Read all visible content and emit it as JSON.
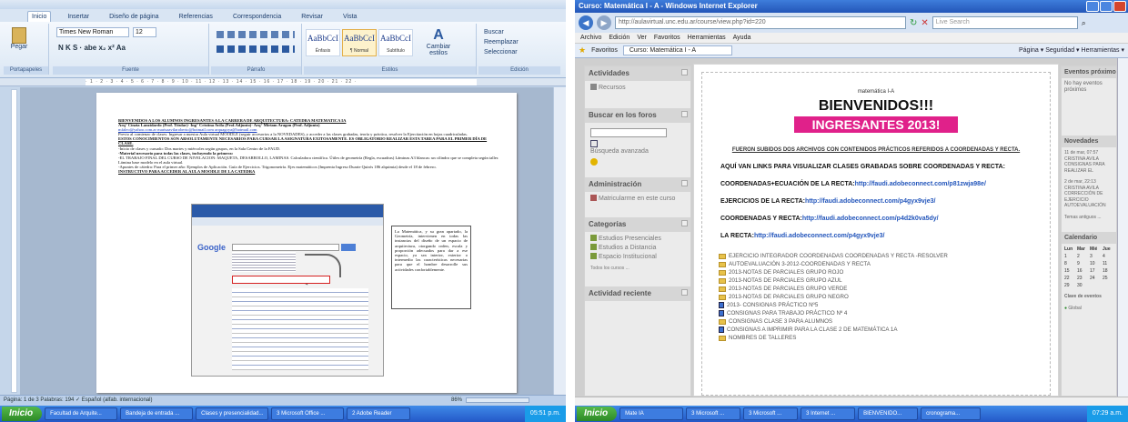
{
  "word": {
    "tabs": [
      "Inicio",
      "Insertar",
      "Diseño de página",
      "Referencias",
      "Correspondencia",
      "Revisar",
      "Vista"
    ],
    "paste_label": "Pegar",
    "font_name": "Times New Roman",
    "font_size": "12",
    "format_row": "N K S · abe x₂ x² Aa",
    "group_labels": [
      "Portapapeles",
      "Fuente",
      "Párrafo",
      "Estilos",
      "Edición"
    ],
    "styles": [
      {
        "sample": "AaBbCcI",
        "name": "Énfasis"
      },
      {
        "sample": "AaBbCcI",
        "name": "¶ Normal"
      },
      {
        "sample": "AaBbCcI",
        "name": "Subtítulo"
      }
    ],
    "change_styles": "Cambiar estilos",
    "edit_items": [
      "Buscar",
      "Reemplazar",
      "Seleccionar"
    ],
    "doc": {
      "heading": "BIENVENIDOS A LOS ALUMNOS INGRESANTES A LA CARRERA DE ARQUITECTURA: CATEDRA MATEMATICA IA",
      "staff": "Arq° Cinzia Lanzidardo (Prof. Titular)- Ing° Cristina Avila (Prof.Adjunto)- Arq° Miriam Aragon (Prof. Adjunto)",
      "emails": "mfaleo@yahoo.com.ar  marisaavilaroberto@hotmail.com  arquagoya@hotmail.com",
      "p1": "Previo al comienzo de clases: Ingresar a nuestra Aula virtual MOODLE (seguir accesorios a la NOVEDADES), y acceder a las clases grabadas, teoría y práctica, resolver la Ejercitación en hojas cuadriculadas.",
      "p2": "ESTOS CONOCIMIENTOS SON ABSOLUTAMENTE NECESARIOS PARA CURSAR LA ASIGNATURA EXITOSAMENTE. ES OBLIGATORIO REALIZAR ESTA TAREA PARA EL PRIMER DÍA DE CLASE.",
      "p3": "-Inicio de clases y cursado: Dos martes y miércoles según grupos, en la Sala Centro de la FAUD.",
      "p4": "-Material necesario para todas las clases, incluyendo la primera:",
      "p5": "-EL TRABAJO FINAL DEL CURSO DE NIVELACION: MAQUETA, DESARROLLO, LAMINAS. Calculadora científica. Útiles de geometría (Regla, escuadras) Láminas A3 blancas: un cilindro que se completa según taller. Lámina base modelo en el aula virtual.",
      "p6": "-Apuntes de cátedra: Para el primer año: Ejemplos de Aplicación. Guía de Ejercicios. Trigonometría. Ejes matemáticos (Imprenta Ingreso Duarte Quirós 186 alquimia) desde el 18 de febrero.",
      "p7": "INSTRUCTIVO PARA ACCEDER AL AULA MOODLE DE LA CATEDRA",
      "side_note": "La Matemática, y su gran apartado, la Geometría, intervienen en todas las instancias del diseño de un espacio de arquitectura, otorgando orden, escala y proporción adecuados para dar a ese espacio, ya sea interior, exterior o intermedio las características necesarias para que el hombre desarrolle sus actividades confortablemente.",
      "google": "Google"
    },
    "status": "Página: 1 de 3    Palabras: 194    ✓    Español (alfab. internacional)",
    "zoom": "86%"
  },
  "ie": {
    "title": "Curso: Matemática I - A - Windows Internet Explorer",
    "url": "http://aulavirtual.unc.edu.ar/course/view.php?id=220",
    "live_search": "Live Search",
    "menu": [
      "Archivo",
      "Edición",
      "Ver",
      "Favoritos",
      "Herramientas",
      "Ayuda"
    ],
    "favorites": "Favoritos",
    "tab": "Curso: Matemática I - A",
    "tools": "Página ▾  Seguridad ▾  Herramientas ▾",
    "left": {
      "actividades": "Actividades",
      "recursos": "Recursos",
      "buscar": "Buscar en los foros",
      "busq_avanzada": "Búsqueda avanzada",
      "administracion": "Administración",
      "matricularme": "Matricularme en este curso",
      "categorias": "Categorías",
      "cats": [
        "Estudios Presenciales",
        "Estudios a Distancia",
        "Espacio Institucional"
      ],
      "todos": "Todos los cursos ...",
      "actividad_reciente": "Actividad reciente"
    },
    "main": {
      "course": "matemática I-A",
      "bienvenidos": "BIENVENIDOS!!!",
      "ingresantes": "INGRESANTES 2013!",
      "fueron": "FUERON SUBIDOS DOS ARCHIVOS CON CONTENIDOS PRÁCTICOS REFERIDOS A COORDENADAS Y RECTA.",
      "aqui": "AQUÍ VAN LINKS PARA VISUALIZAR CLASES GRABADAS SOBRE COORDENADAS Y RECTA:",
      "links": [
        {
          "label": "COORDENADAS+ECUACIÓN DE LA RECTA:",
          "url": "http://faudi.adobeconnect.com/p81zwja98e/"
        },
        {
          "label": "EJERCICIOS DE LA RECTA:",
          "url": "http://faudi.adobeconnect.com/p4gyx9vje3/"
        },
        {
          "label": "COORDENADAS Y RECTA:",
          "url": "http://faudi.adobeconnect.com/p4d2k0va5dy/"
        },
        {
          "label": "LA RECTA:",
          "url": "http://faudi.adobeconnect.com/p4gyx9vje3/"
        }
      ],
      "files": [
        {
          "name": "EJERCICIO INTEGRADOR COORDENADAS COORDENADAS Y RECTA -RESOLVER",
          "type": "folder"
        },
        {
          "name": "AUTOEVALUACIÓN 3-2012-COORDENADAS Y RECTA",
          "type": "folder"
        },
        {
          "name": "2013-NOTAS DE PARCIALES GRUPO ROJO",
          "type": "folder"
        },
        {
          "name": "2013-NOTAS DE PARCIALES GRUPO AZUL",
          "type": "folder"
        },
        {
          "name": "2013-NOTAS DE PARCIALES GRUPO VERDE",
          "type": "folder"
        },
        {
          "name": "2013-NOTAS DE PARCIALES GRUPO NEGRO",
          "type": "folder"
        },
        {
          "name": "2013- CONSIGNAS PRÁCTICO Nº5",
          "type": "doc"
        },
        {
          "name": "CONSIGNAS PARA TRABAJO PRÁCTICO Nº 4",
          "type": "doc"
        },
        {
          "name": "CONSIGNAS CLASE 3 PARA ALUMNOS",
          "type": "folder"
        },
        {
          "name": "CONSIGNAS A IMPRIMIR PARA LA CLASE 2 DE MATEMÁTICA 1A",
          "type": "doc"
        },
        {
          "name": "NOMBRES DE TALLERES",
          "type": "folder"
        }
      ]
    },
    "right": {
      "eventos": "Eventos próximos",
      "no_eventos": "No hay eventos próximos",
      "novedades": "Novedades",
      "news": [
        "11 de mar, 07:57 CRISTINA AVILA CONSIGNAS PARA REALIZAR EL",
        "2 de mar, 22:13 CRISTINA AVILA CORRECCIÓN DE EJERCICIO AUTOEVALUACIÓN",
        "Temas antiguos ..."
      ],
      "calendario": "Calendario",
      "cal_head": [
        "Lun",
        "Mar",
        "Mié",
        "Jue"
      ],
      "cal_days": [
        "1",
        "2",
        "3",
        "4",
        "8",
        "9",
        "10",
        "11",
        "15",
        "16",
        "17",
        "18",
        "22",
        "23",
        "24",
        "25",
        "29",
        "30",
        "",
        ""
      ],
      "clave": "Clave de eventos",
      "global": "Global"
    }
  },
  "taskbar_left": {
    "start": "Inicio",
    "items": [
      "Facultad de Arquite...",
      "Bandeja de entrada ...",
      "Clases y presencialidad...",
      "3 Microsoft Office ...",
      "2 Adobe Reader"
    ],
    "clock": "05:51 p.m."
  },
  "taskbar_right": {
    "start": "Inicio",
    "items": [
      "Mate IA",
      "3 Microsoft ...",
      "3 Microsoft ...",
      "3 Internet ...",
      "BIENVENIDO...",
      "cronograma..."
    ],
    "clock": "07:29 a.m."
  }
}
